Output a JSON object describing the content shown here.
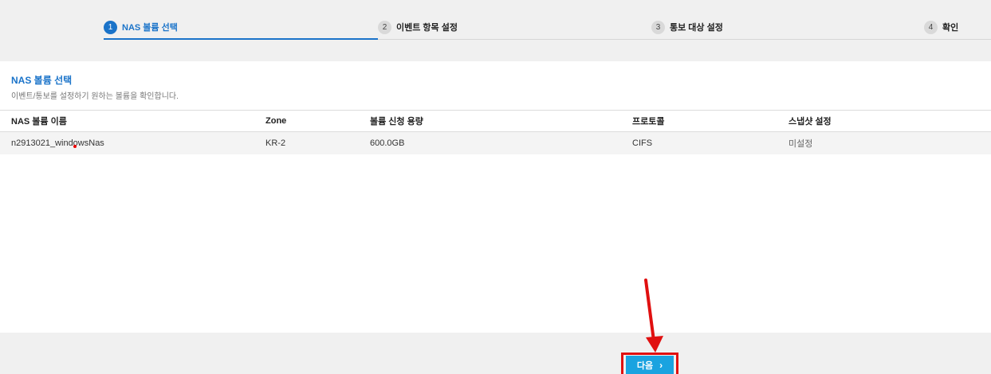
{
  "stepper": {
    "steps": [
      {
        "num": "1",
        "label": "NAS 볼륨 선택",
        "active": true
      },
      {
        "num": "2",
        "label": "이벤트 항목 설정",
        "active": false
      },
      {
        "num": "3",
        "label": "통보 대상 설정",
        "active": false
      },
      {
        "num": "4",
        "label": "확인",
        "active": false
      }
    ]
  },
  "section": {
    "title": "NAS 볼륨 선택",
    "description": "이벤트/통보를 설정하기 원하는 볼륨을 확인합니다."
  },
  "table": {
    "columns": [
      "NAS 볼륨 이름",
      "Zone",
      "볼륨 신청 용량",
      "프로토콜",
      "스냅샷 설정"
    ],
    "rows": [
      [
        "n2913021_windowsNas",
        "KR-2",
        "600.0GB",
        "CIFS",
        "미설정"
      ]
    ]
  },
  "footer": {
    "next_label": "다음",
    "next_chevron": "›"
  },
  "colors": {
    "accent": "#1a73c9",
    "button": "#1aa3e0",
    "annotation": "#e01010"
  }
}
